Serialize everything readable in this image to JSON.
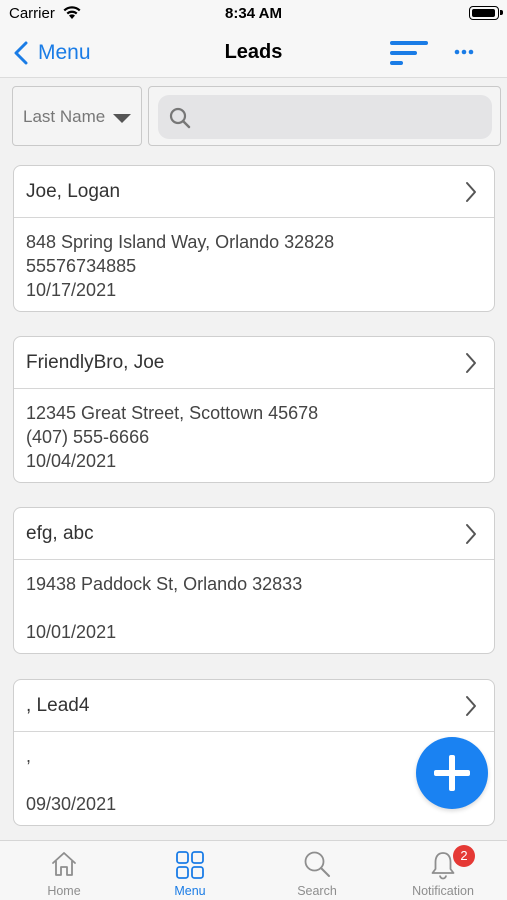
{
  "status_bar": {
    "carrier": "Carrier",
    "time": "8:34 AM"
  },
  "nav": {
    "back_label": "Menu",
    "title": "Leads"
  },
  "filter": {
    "sort_field": "Last Name",
    "search_placeholder": "",
    "search_value": ""
  },
  "leads": [
    {
      "name": "Joe, Logan",
      "address": "848 Spring Island Way, Orlando 32828",
      "phone": "55576734885",
      "date": "10/17/2021"
    },
    {
      "name": "FriendlyBro, Joe",
      "address": "12345 Great Street, Scottown 45678",
      "phone": "(407) 555-6666",
      "date": "10/04/2021"
    },
    {
      "name": "efg, abc",
      "address": "19438 Paddock St, Orlando 32833",
      "phone": "",
      "date": "10/01/2021"
    },
    {
      "name": ", Lead4",
      "address": ",",
      "phone": "",
      "date": "09/30/2021"
    }
  ],
  "tabs": [
    {
      "label": "Home",
      "icon": "home-icon",
      "active": false
    },
    {
      "label": "Menu",
      "icon": "grid-icon",
      "active": true
    },
    {
      "label": "Search",
      "icon": "search-icon",
      "active": false
    },
    {
      "label": "Notification",
      "icon": "bell-icon",
      "active": false,
      "badge": "2"
    }
  ],
  "colors": {
    "accent": "#1a7ce6",
    "fab": "#1a82f2",
    "badge": "#e53935"
  }
}
